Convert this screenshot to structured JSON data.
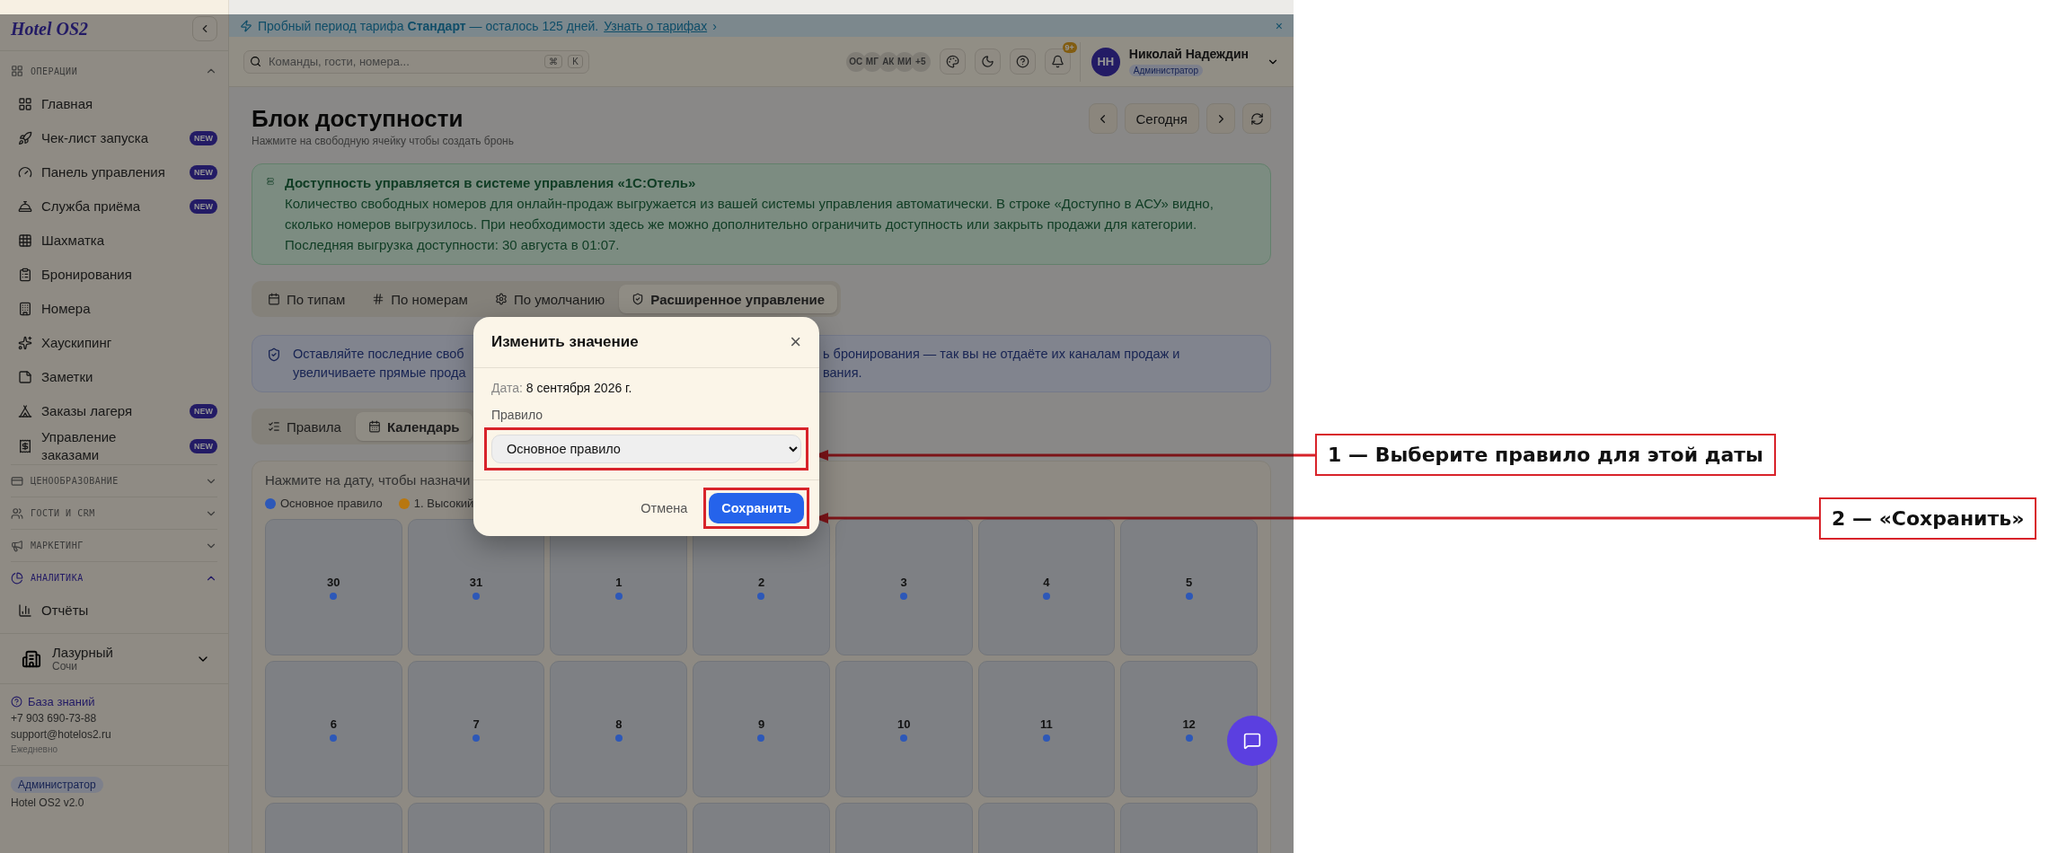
{
  "sidebar": {
    "logo": "Hotel OS2",
    "sections": [
      {
        "title": "ОПЕРАЦИИ",
        "expanded": true,
        "active": false,
        "items": [
          {
            "label": "Главная"
          },
          {
            "label": "Чек-лист запуска",
            "badge": "NEW"
          },
          {
            "label": "Панель управления",
            "badge": "NEW"
          },
          {
            "label": "Служба приёма",
            "badge": "NEW"
          },
          {
            "label": "Шахматка"
          },
          {
            "label": "Бронирования"
          },
          {
            "label": "Номера"
          },
          {
            "label": "Хаускипинг"
          },
          {
            "label": "Заметки"
          },
          {
            "label": "Заказы лагеря",
            "badge": "NEW"
          },
          {
            "label": "Управление заказами",
            "badge": "NEW"
          }
        ]
      },
      {
        "title": "ЦЕНООБРАЗОВАНИЕ",
        "expanded": false,
        "active": false
      },
      {
        "title": "ГОСТИ И CRM",
        "expanded": false,
        "active": false
      },
      {
        "title": "МАРКЕТИНГ",
        "expanded": false,
        "active": false
      },
      {
        "title": "АНАЛИТИКА",
        "expanded": true,
        "active": true,
        "items": [
          {
            "label": "Отчёты"
          }
        ]
      }
    ],
    "hotel": {
      "name": "Лазурный",
      "city": "Сочи"
    },
    "support": {
      "link": "База знаний",
      "phone": "+7 903 690-73-88",
      "email": "support@hotelos2.ru",
      "hours": "Ежедневно"
    },
    "role": "Администратор",
    "version": "Hotel OS2 v2.0"
  },
  "banner": {
    "text": "Пробный период тарифа **Стандарт** — осталось 125 дней.",
    "link": "Узнать о тарифах",
    "chevron": "›",
    "close": "×"
  },
  "topbar": {
    "search": {
      "placeholder": "Команды, гости, номера...",
      "keys": [
        "⌘",
        "K"
      ]
    },
    "avatars": [
      "ОС",
      "МГ",
      "АК",
      "МИ",
      "+5"
    ],
    "notifications": "9+",
    "user": {
      "initials": "НН",
      "name": "Николай Надеждин",
      "role": "Администратор"
    }
  },
  "page": {
    "title": "Блок доступности",
    "subtitle": "Нажмите на свободную ячейку чтобы создать бронь",
    "today": "Сегодня",
    "notice": {
      "title": "Доступность управляется в системе управления «1С:Отель»",
      "text": "Количество свободных номеров для онлайн-продаж выгружается из вашей системы управления автоматически. В строке «Доступно в АСУ» видно, сколько номеров выгрузилось. При необходимости здесь же можно дополнительно ограничить доступность или закрыть продажи для категории. Последняя выгрузка доступности: 30 августа в 01:07."
    },
    "tabs": [
      {
        "label": "По типам",
        "selected": false
      },
      {
        "label": "По номерам",
        "selected": false
      },
      {
        "label": "По умолчанию",
        "selected": false
      },
      {
        "label": "Расширенное управление",
        "selected": true
      }
    ],
    "tip": {
      "left": [
        "Оставляйте последние своб",
        "увеличиваете прямые прода"
      ],
      "right": [
        "ь бронирования — так вы не отдаёте их каналам продаж и",
        "вания."
      ]
    },
    "subtabs": [
      {
        "label": "Правила",
        "selected": false
      },
      {
        "label": "Календарь",
        "selected": true
      }
    ],
    "calendar": {
      "hint": "Нажмите на дату, чтобы назначи",
      "legend": [
        {
          "label": "Основное правило",
          "color": "#2d58b8"
        },
        {
          "label": "1. Высокий",
          "color": "#b8770f"
        }
      ],
      "days": [
        {
          "day": "30",
          "color": "#2d58b8"
        },
        {
          "day": "31",
          "color": "#2d58b8"
        },
        {
          "day": "1",
          "color": "#2d58b8"
        },
        {
          "day": "2",
          "color": "#2d58b8"
        },
        {
          "day": "3",
          "color": "#2d58b8"
        },
        {
          "day": "4",
          "color": "#2d58b8"
        },
        {
          "day": "5",
          "color": "#2d58b8"
        },
        {
          "day": "6",
          "color": "#2d58b8"
        },
        {
          "day": "7",
          "color": "#2d58b8"
        },
        {
          "day": "8",
          "color": "#2d58b8"
        },
        {
          "day": "9",
          "color": "#2d58b8"
        },
        {
          "day": "10",
          "color": "#2d58b8"
        },
        {
          "day": "11",
          "color": "#2d58b8"
        },
        {
          "day": "12",
          "color": "#2d58b8"
        }
      ]
    }
  },
  "dialog": {
    "title": "Изменить значение",
    "close": "×",
    "date_label": "Дата:",
    "date": "8 сентября 2026 г.",
    "rule_label": "Правило",
    "rule": "Основное правило",
    "cancel": "Отмена",
    "save": "Сохранить"
  },
  "annotations": [
    {
      "text": "1 — Выберите правило для этой даты"
    },
    {
      "text": "2 — «Сохранить»"
    }
  ]
}
